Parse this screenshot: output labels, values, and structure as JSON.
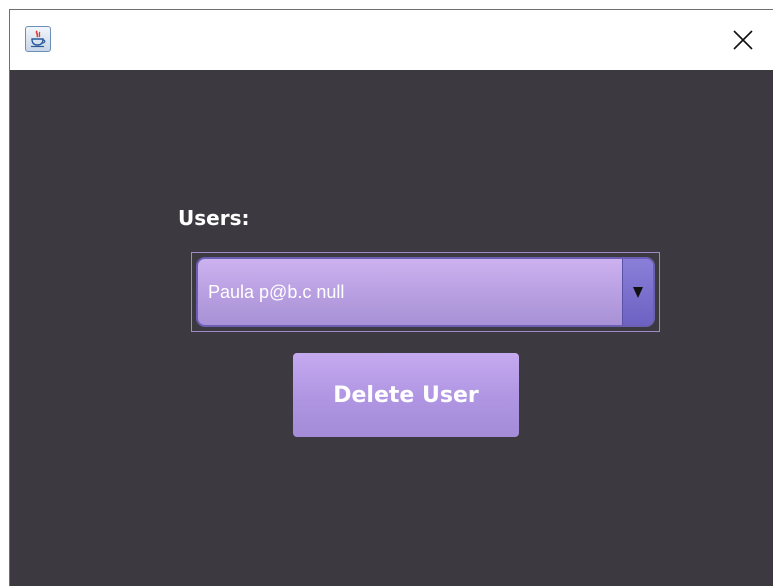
{
  "window": {
    "title": "",
    "app_icon": "java-cup-icon",
    "close_glyph": "✕"
  },
  "form": {
    "users_label": "Users:",
    "users_select": {
      "selected": "Paula p@b.c null"
    },
    "delete_button_label": "Delete User"
  },
  "colors": {
    "background": "#3c3a40",
    "accent_purple": "#b9a0e2",
    "arrow_button": "#7a6fd0"
  }
}
